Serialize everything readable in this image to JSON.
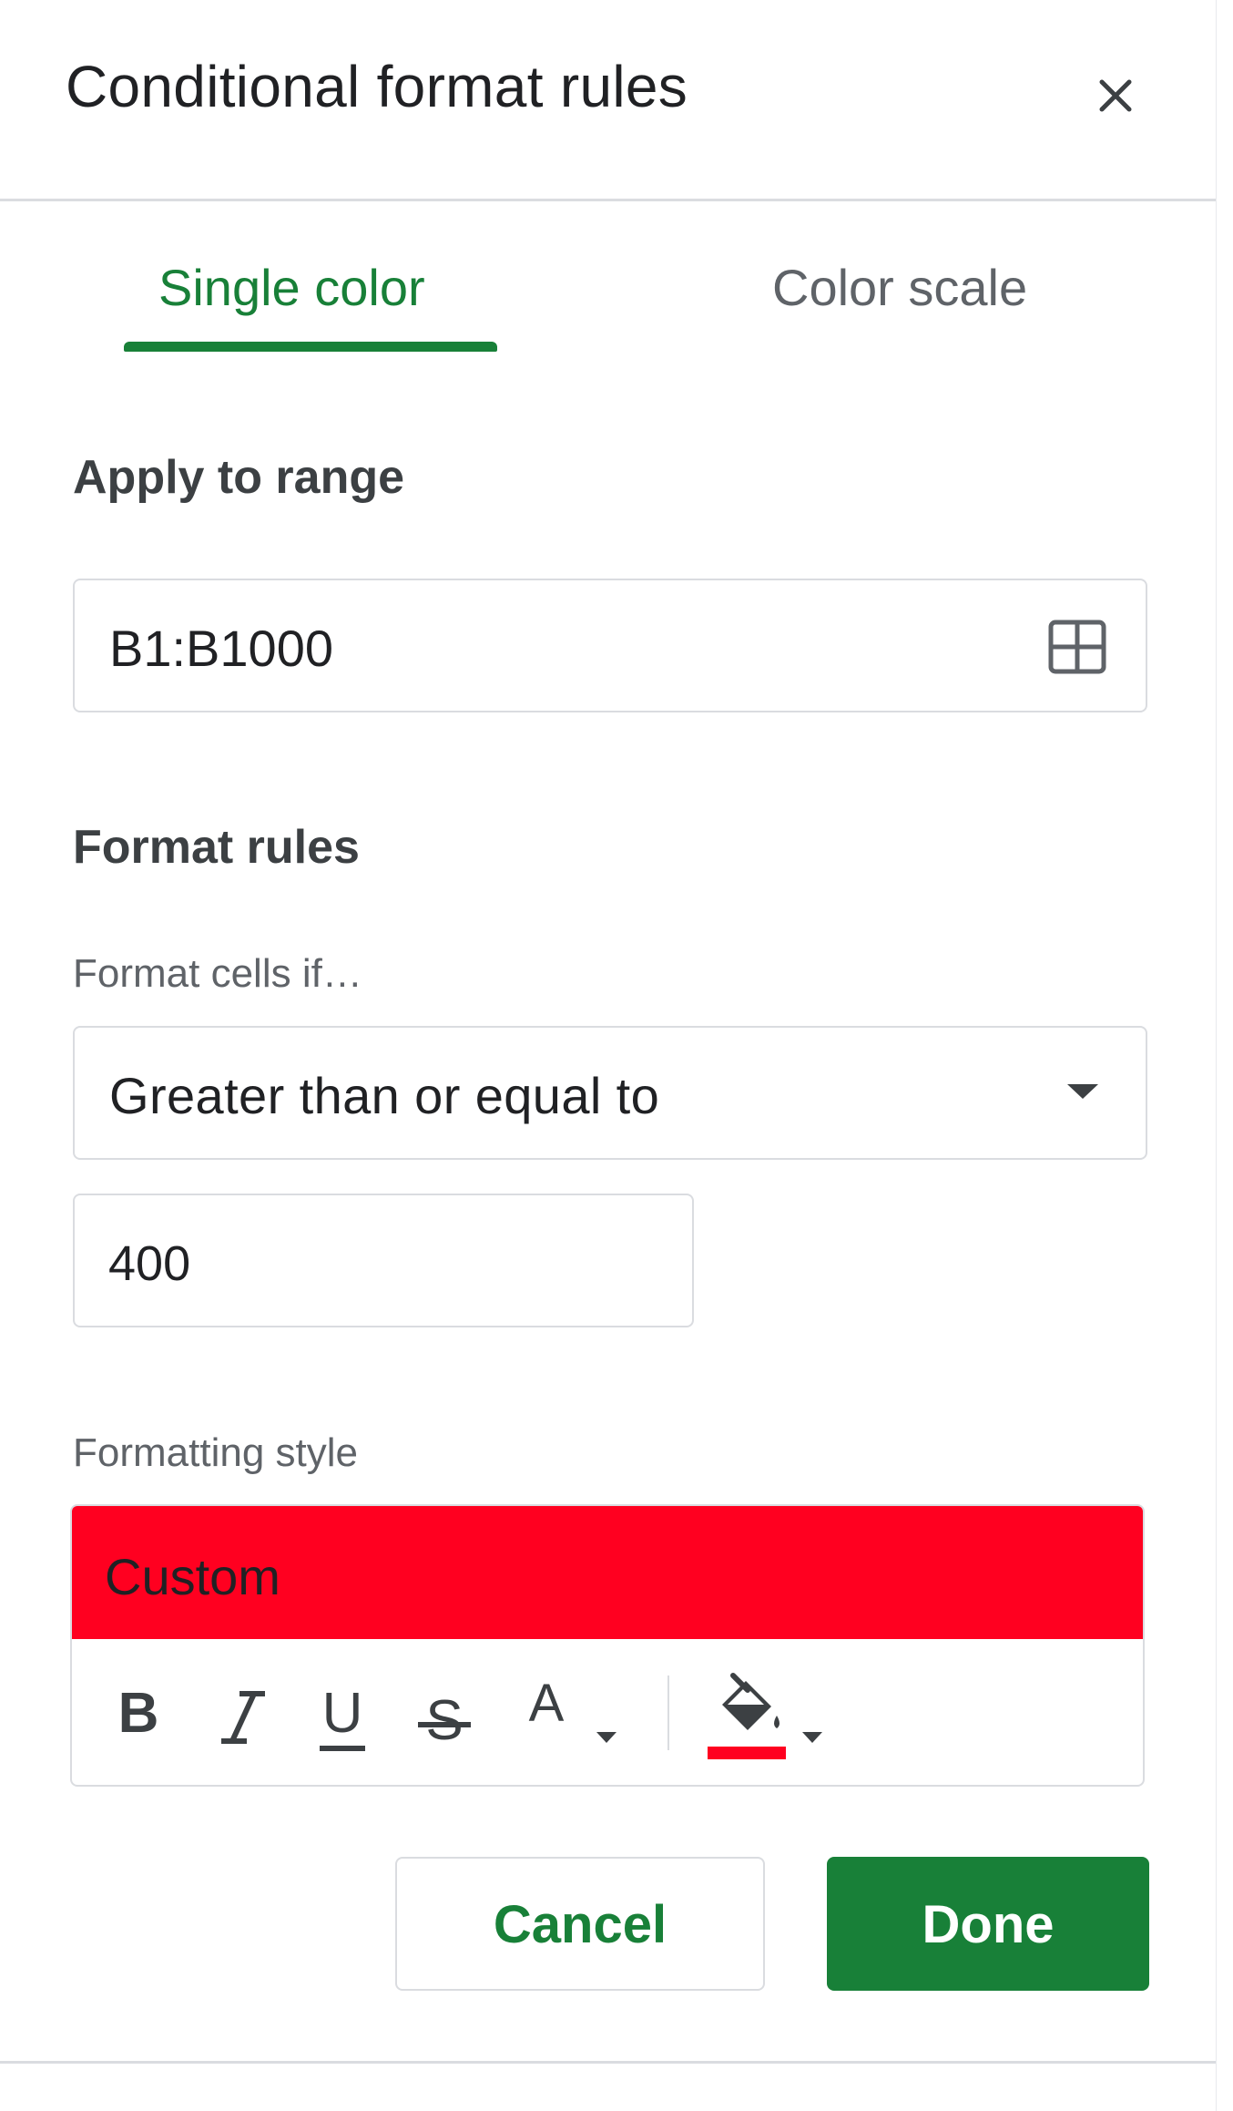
{
  "panel": {
    "title": "Conditional format rules",
    "close_icon": "close-icon"
  },
  "tabs": [
    {
      "label": "Single color",
      "active": true
    },
    {
      "label": "Color scale",
      "active": false
    }
  ],
  "apply_range": {
    "label": "Apply to range",
    "value": "B1:B1000",
    "icon": "select-range-grid-icon"
  },
  "format_rules": {
    "label": "Format rules",
    "condition_label": "Format cells if…",
    "condition_value": "Greater than or equal to",
    "value": "400"
  },
  "formatting_style": {
    "label": "Formatting style",
    "preview_text": "Custom",
    "preview_fill": "#ff0020",
    "toolbar": {
      "bold": "B",
      "italic": "I",
      "underline": "U",
      "strikethrough": "S",
      "text_color": "A",
      "fill_color_swatch": "#ff0020"
    }
  },
  "actions": {
    "cancel": "Cancel",
    "done": "Done"
  },
  "colors": {
    "accent": "#188038",
    "border": "#dadce0"
  }
}
